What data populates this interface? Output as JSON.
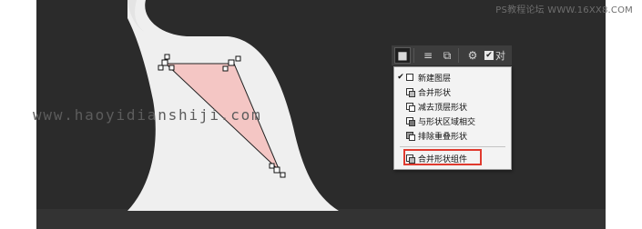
{
  "watermark_top": "PS教程论坛 WWW.16XX8.COM",
  "watermark_mid": "www.haoyidianshiji.com",
  "toolbar": {
    "buttons": [
      "shape-mode",
      "align",
      "arrange",
      "settings"
    ],
    "checkbox_checked": true,
    "text": "对"
  },
  "menu": {
    "items": [
      {
        "label": "新建图层",
        "checked": true,
        "icon": "new-layer-icon"
      },
      {
        "label": "合并形状",
        "checked": false,
        "icon": "combine-shapes-icon"
      },
      {
        "label": "减去顶层形状",
        "checked": false,
        "icon": "subtract-front-shape-icon"
      },
      {
        "label": "与形状区域相交",
        "checked": false,
        "icon": "intersect-shape-areas-icon"
      },
      {
        "label": "排除重叠形状",
        "checked": false,
        "icon": "exclude-overlapping-shapes-icon"
      }
    ],
    "merge_item": {
      "label": "合并形状组件",
      "icon": "merge-shape-components-icon"
    }
  },
  "colors": {
    "dark_bg": "#2b2b2b",
    "paper": "#efefef",
    "shape_fill": "#f4c6c4",
    "highlight": "#e03a2e"
  }
}
